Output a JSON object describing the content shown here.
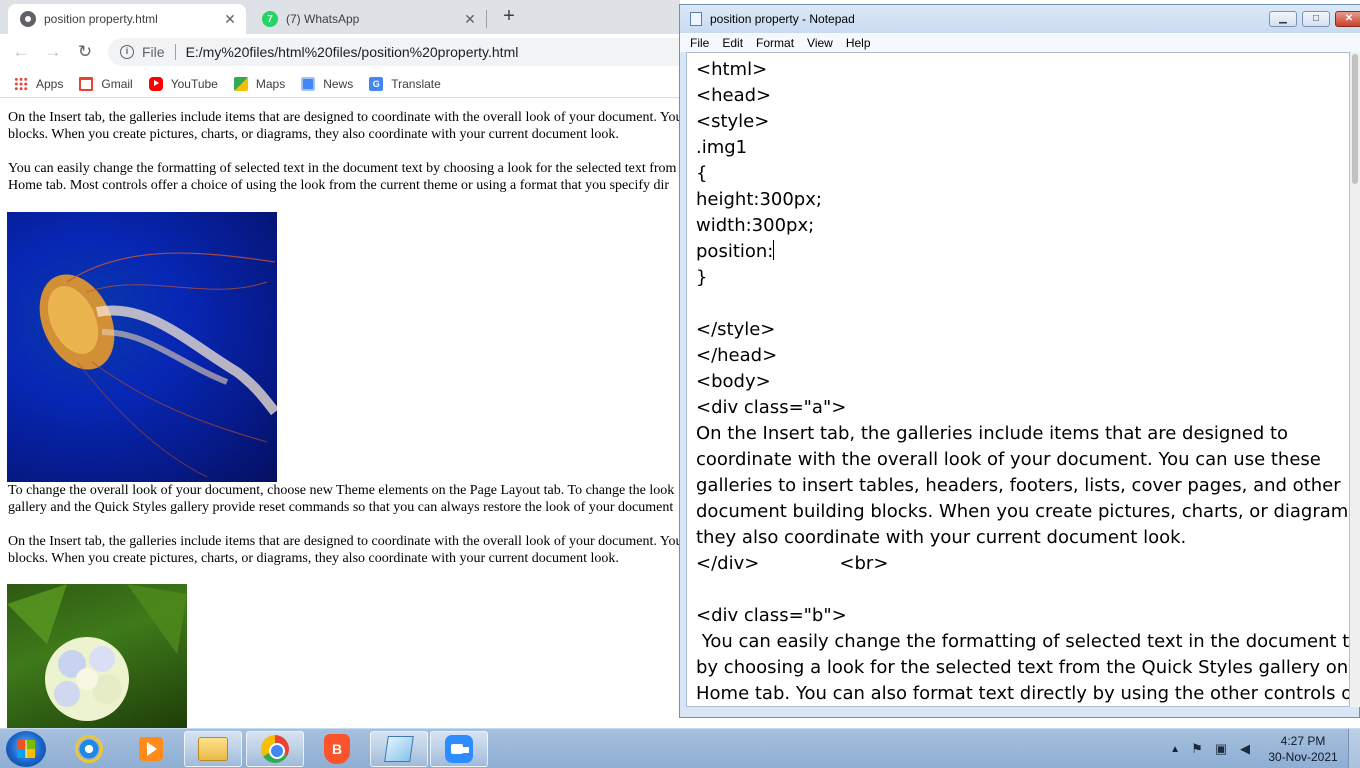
{
  "browser": {
    "tabs": [
      {
        "title": "position property.html",
        "active": true
      },
      {
        "title": "(7) WhatsApp",
        "active": false
      }
    ],
    "favicon_wa": "7",
    "address": {
      "scheme": "File",
      "url": "E:/my%20files/html%20files/position%20property.html"
    },
    "bookmarks": [
      {
        "label": "Apps",
        "icon": "apps-icon"
      },
      {
        "label": "Gmail",
        "icon": "gmail-icon"
      },
      {
        "label": "YouTube",
        "icon": "youtube-icon"
      },
      {
        "label": "Maps",
        "icon": "maps-icon"
      },
      {
        "label": "News",
        "icon": "news-icon"
      },
      {
        "label": "Translate",
        "icon": "translate-icon"
      }
    ],
    "page": {
      "p1": [
        "On the Insert tab, the galleries include items that are designed to coordinate with the overall look of your document. You",
        "blocks. When you create pictures, charts, or diagrams, they also coordinate with your current document look."
      ],
      "p2": [
        "You can easily change the formatting of selected text in the document text by choosing a look for the selected text from",
        "Home tab. Most controls offer a choice of using the look from the current theme or using a format that you specify dir"
      ],
      "p3": [
        "To change the overall look of your document, choose new Theme elements on the Page Layout tab. To change the look",
        "gallery and the Quick Styles gallery provide reset commands so that you can always restore the look of your document"
      ],
      "p4": [
        "On the Insert tab, the galleries include items that are designed to coordinate with the overall look of your document. You",
        "blocks. When you create pictures, charts, or diagrams, they also coordinate with your current document look."
      ]
    }
  },
  "notepad": {
    "title": "position property - Notepad",
    "menu": [
      "File",
      "Edit",
      "Format",
      "View",
      "Help"
    ],
    "window_buttons": {
      "minimize": "▁",
      "maximize": "□",
      "close": "✕"
    },
    "lines": [
      "<html>",
      "<head>",
      "<style>",
      ".img1",
      "{",
      "height:300px;",
      "width:300px;",
      "position:",
      "}",
      "",
      "</style>",
      "</head>",
      "<body>",
      "<div class=\"a\">",
      "On the Insert tab, the galleries include items that are designed to",
      "coordinate with the overall look of your document. You can use these",
      "galleries to insert tables, headers, footers, lists, cover pages, and other",
      "document building blocks. When you create pictures, charts, or diagrams,",
      "they also coordinate with your current document look.",
      "</div>              <br>",
      "",
      "<div class=\"b\">",
      " You can easily change the formatting of selected text in the document text",
      "by choosing a look for the selected text from the Quick Styles gallery on the",
      "Home tab. You can also format text directly by using the other controls on"
    ],
    "caret_line": 7
  },
  "taskbar": {
    "clock_time": "4:27 PM",
    "clock_date": "30-Nov-2021",
    "tray_icons": [
      "show-hidden-icons-icon",
      "action-center-flag-icon",
      "network-icon",
      "volume-icon"
    ]
  }
}
